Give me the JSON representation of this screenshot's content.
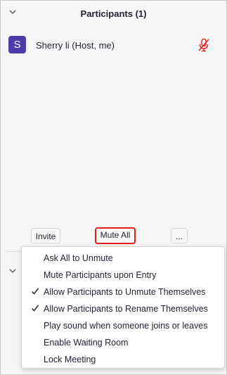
{
  "panel": {
    "title": "Participants",
    "count": "(1)"
  },
  "participants": [
    {
      "initial": "S",
      "name": "Sherry li (Host, me)",
      "avatar_color": "#4d3aab",
      "mic_status": "muted"
    }
  ],
  "footer": {
    "invite_label": "Invite",
    "mute_all_label": "Mute All",
    "more_label": "...",
    "highlight_color": "#e0201e"
  },
  "menu": {
    "items": [
      {
        "label": "Ask All to Unmute",
        "checked": false
      },
      {
        "label": "Mute Participants upon Entry",
        "checked": false
      },
      {
        "label": "Allow Participants to Unmute Themselves",
        "checked": true
      },
      {
        "label": "Allow Participants to Rename Themselves",
        "checked": true
      },
      {
        "label": "Play sound when someone joins or leaves",
        "checked": false
      },
      {
        "label": "Enable Waiting Room",
        "checked": false
      },
      {
        "label": "Lock Meeting",
        "checked": false
      }
    ]
  },
  "icons": {
    "collapse": "chevron-down-icon",
    "mic": "mic-muted-icon",
    "check": "checkmark-icon"
  }
}
